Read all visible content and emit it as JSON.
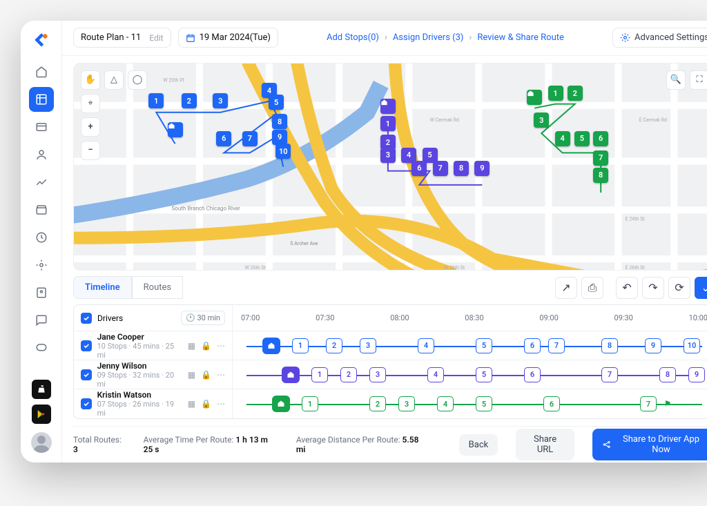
{
  "header": {
    "plan_name": "Route Plan - 11",
    "edit_label": "Edit",
    "date_label": "19 Mar 2024(Tue)"
  },
  "breadcrumbs": {
    "step1": "Add Stops(0)",
    "step2": "Assign Drivers (3)",
    "step3": "Review & Share Route"
  },
  "advanced_label": "Advanced Settings",
  "tabs": {
    "timeline": "Timeline",
    "routes": "Routes"
  },
  "timeline_header": {
    "drivers_label": "Drivers",
    "interval": "30 min",
    "ticks": [
      "07:00",
      "07:30",
      "08:00",
      "08:30",
      "09:00",
      "09:30",
      "10:00"
    ]
  },
  "drivers": [
    {
      "name": "Jane Cooper",
      "meta": "10 Stops  ·  45 mins  ·  25 mi",
      "color": "blue",
      "stops": [
        8,
        14,
        21,
        28,
        40,
        52,
        62,
        67,
        78,
        87,
        95
      ],
      "flag": 100
    },
    {
      "name": "Jenny Wilson",
      "meta": "09 Stops  ·  32 mins  ·  20 mi",
      "color": "purple",
      "stops": [
        12,
        18,
        24,
        30,
        42,
        52,
        62,
        78,
        90,
        96
      ],
      "flag": 99
    },
    {
      "name": "Kristin Watson",
      "meta": "07 Stops  ·  26 mins  ·  19 mi",
      "color": "green",
      "stops": [
        10,
        16,
        30,
        36,
        44,
        52,
        66,
        86
      ],
      "flag": 90
    }
  ],
  "footer": {
    "routes_label": "Total Routes:",
    "routes_value": "3",
    "avg_time_label": "Average Time Per Route:",
    "avg_time_value": "1 h 13 m 25 s",
    "avg_dist_label": "Average Distance Per Route:",
    "avg_dist_value": "5.58 mi",
    "back": "Back",
    "share_url": "Share URL",
    "share_driver": "Share to Driver App Now"
  },
  "map_routes": {
    "blue": {
      "home": [
        145,
        115
      ],
      "pts": [
        [
          118,
          70
        ],
        [
          165,
          70
        ],
        [
          210,
          70
        ],
        [
          280,
          54
        ],
        [
          290,
          72
        ],
        [
          215,
          128
        ],
        [
          252,
          128
        ],
        [
          295,
          102
        ],
        [
          295,
          126
        ],
        [
          300,
          148
        ]
      ]
    },
    "purple": {
      "home": [
        450,
        78
      ],
      "pts": [
        [
          450,
          105
        ],
        [
          450,
          134
        ],
        [
          450,
          154
        ],
        [
          480,
          154
        ],
        [
          510,
          154
        ],
        [
          495,
          174
        ],
        [
          525,
          174
        ],
        [
          555,
          174
        ],
        [
          585,
          174
        ]
      ]
    },
    "green": {
      "home": [
        660,
        64
      ],
      "pts": [
        [
          690,
          58
        ],
        [
          718,
          58
        ],
        [
          670,
          100
        ],
        [
          700,
          128
        ],
        [
          728,
          128
        ],
        [
          755,
          128
        ],
        [
          755,
          158
        ],
        [
          755,
          185
        ]
      ]
    }
  }
}
